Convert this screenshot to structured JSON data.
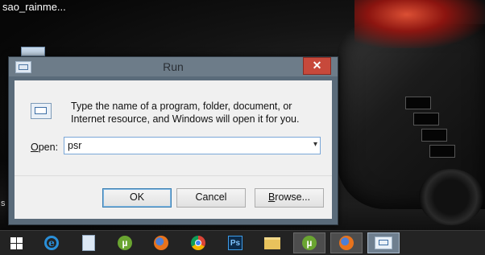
{
  "desktop": {
    "icon_label": "sao_rainme...",
    "side_text": "s"
  },
  "run_dialog": {
    "title": "Run",
    "close_glyph": "✕",
    "description": "Type the name of a program, folder, document, or Internet resource, and Windows will open it for you.",
    "open_label_underlined": "O",
    "open_label_rest": "pen:",
    "open_value": "psr",
    "dropdown_glyph": "▾",
    "ok_label": "OK",
    "cancel_label": "Cancel",
    "browse_label_underlined": "B",
    "browse_label_rest": "rowse...",
    "accent_color": "#c7493b"
  },
  "taskbar": {
    "items": [
      {
        "icon": "windows-start-icon"
      },
      {
        "icon": "internet-explorer-icon",
        "glyph": "e"
      },
      {
        "icon": "sticky-notes-icon"
      },
      {
        "icon": "utorrent-icon",
        "glyph": "µ"
      },
      {
        "icon": "firefox-icon"
      },
      {
        "icon": "chrome-icon"
      },
      {
        "icon": "photoshop-icon",
        "glyph": "Ps"
      },
      {
        "icon": "file-explorer-icon"
      },
      {
        "icon": "utorrent-icon",
        "glyph": "µ"
      },
      {
        "icon": "firefox-icon"
      },
      {
        "icon": "run-icon"
      }
    ]
  }
}
